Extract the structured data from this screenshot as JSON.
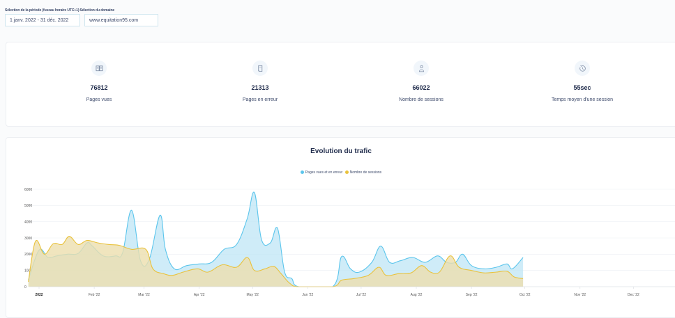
{
  "filters": {
    "period_label": "Sélection de la période (fuseau horaire UTC+1)",
    "domain_label": "Sélection du domaine",
    "period_value": "1 janv. 2022 - 31 déc. 2022",
    "domain_value": "www.equitation95.com"
  },
  "stats": [
    {
      "icon": "open-book-icon",
      "value": "76812",
      "label": "Pages vues"
    },
    {
      "icon": "broken-page-icon",
      "value": "21313",
      "label": "Pages en erreur"
    },
    {
      "icon": "person-icon",
      "value": "66022",
      "label": "Nombre de sessions"
    },
    {
      "icon": "clock-icon",
      "value": "55sec",
      "label": "Temps moyen d'une session"
    }
  ],
  "colors": {
    "blue_line": "#5bc5ec",
    "blue_fill": "#bfe6f6",
    "yellow_line": "#e9c23c",
    "yellow_fill": "#ecdfae"
  },
  "chart_data": {
    "type": "area",
    "title": "Evolution du trafic",
    "ylim": [
      0,
      6000
    ],
    "y_ticks": [
      0,
      1000,
      2000,
      3000,
      4000,
      5000,
      6000
    ],
    "x_tick_labels": [
      "2022",
      "Feb '22",
      "Mar '22",
      "Apr '22",
      "May '22",
      "Jun '22",
      "Jul '22",
      "Aug '22",
      "Sep '22",
      "Oct '22",
      "Nov '22",
      "Dec '22"
    ],
    "x_ticks_day": [
      0,
      31,
      59,
      90,
      120,
      151,
      181,
      212,
      243,
      273,
      304,
      334
    ],
    "legend_position": "top-center",
    "series": [
      {
        "name": "Pages vues et en erreur",
        "points": [
          [
            -6,
            400
          ],
          [
            0,
            2250
          ],
          [
            5,
            1800
          ],
          [
            10,
            1900
          ],
          [
            16,
            2000
          ],
          [
            22,
            2050
          ],
          [
            27,
            2700
          ],
          [
            30,
            2500
          ],
          [
            36,
            1900
          ],
          [
            43,
            1900
          ],
          [
            47,
            2100
          ],
          [
            52,
            4700
          ],
          [
            57,
            1600
          ],
          [
            62,
            1700
          ],
          [
            68,
            4400
          ],
          [
            71,
            2300
          ],
          [
            76,
            1100
          ],
          [
            83,
            1300
          ],
          [
            90,
            1400
          ],
          [
            97,
            1500
          ],
          [
            104,
            2300
          ],
          [
            111,
            2600
          ],
          [
            117,
            4200
          ],
          [
            121,
            5800
          ],
          [
            125,
            2900
          ],
          [
            130,
            2700
          ],
          [
            134,
            3600
          ],
          [
            138,
            900
          ],
          [
            142,
            500
          ],
          [
            146,
            0
          ],
          [
            165,
            0
          ],
          [
            170,
            1850
          ],
          [
            175,
            1100
          ],
          [
            180,
            900
          ],
          [
            187,
            1500
          ],
          [
            192,
            2500
          ],
          [
            197,
            1500
          ],
          [
            203,
            1600
          ],
          [
            210,
            1800
          ],
          [
            217,
            1500
          ],
          [
            224,
            1900
          ],
          [
            229,
            1500
          ],
          [
            234,
            1500
          ],
          [
            238,
            2000
          ],
          [
            243,
            1300
          ],
          [
            250,
            1100
          ],
          [
            257,
            1200
          ],
          [
            263,
            1400
          ],
          [
            266,
            1100
          ],
          [
            272,
            1800
          ]
        ]
      },
      {
        "name": "Nombre de sessions",
        "points": [
          [
            -6,
            300
          ],
          [
            -2,
            2800
          ],
          [
            3,
            2000
          ],
          [
            8,
            2650
          ],
          [
            13,
            2600
          ],
          [
            17,
            3100
          ],
          [
            22,
            2600
          ],
          [
            27,
            2850
          ],
          [
            33,
            2700
          ],
          [
            39,
            2600
          ],
          [
            45,
            2550
          ],
          [
            52,
            2300
          ],
          [
            60,
            2300
          ],
          [
            64,
            1100
          ],
          [
            70,
            800
          ],
          [
            75,
            700
          ],
          [
            81,
            900
          ],
          [
            89,
            1100
          ],
          [
            95,
            900
          ],
          [
            103,
            1350
          ],
          [
            111,
            1200
          ],
          [
            117,
            1800
          ],
          [
            121,
            1000
          ],
          [
            127,
            1100
          ],
          [
            132,
            1250
          ],
          [
            136,
            800
          ],
          [
            141,
            200
          ],
          [
            146,
            0
          ],
          [
            165,
            0
          ],
          [
            170,
            400
          ],
          [
            177,
            500
          ],
          [
            185,
            700
          ],
          [
            191,
            1200
          ],
          [
            195,
            700
          ],
          [
            202,
            800
          ],
          [
            209,
            850
          ],
          [
            215,
            1300
          ],
          [
            220,
            900
          ],
          [
            225,
            900
          ],
          [
            231,
            1900
          ],
          [
            236,
            1200
          ],
          [
            243,
            1000
          ],
          [
            250,
            850
          ],
          [
            257,
            900
          ],
          [
            263,
            950
          ],
          [
            267,
            600
          ],
          [
            272,
            500
          ]
        ]
      }
    ]
  }
}
